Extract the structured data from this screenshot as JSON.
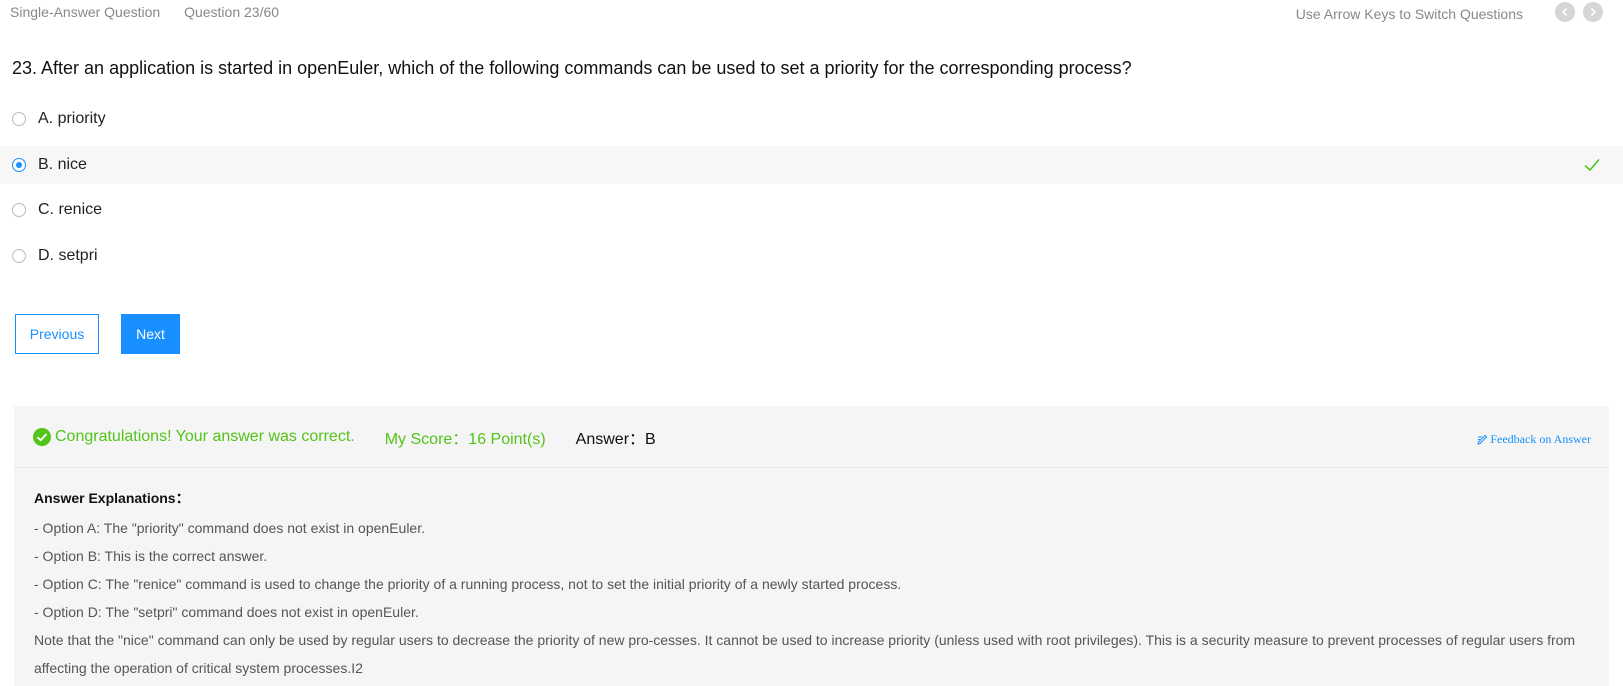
{
  "header": {
    "type": "Single-Answer Question",
    "progress": "Question 23/60",
    "hint": "Use Arrow Keys to Switch Questions",
    "prev_icon": "‹",
    "next_icon": "›"
  },
  "question": {
    "text": "23. After an application is started in openEuler, which of the following commands can be used to set a priority for the corresponding process?"
  },
  "options": [
    {
      "label": "A. priority",
      "selected": false
    },
    {
      "label": "B. nice",
      "selected": true,
      "correct": true
    },
    {
      "label": "C. renice",
      "selected": false
    },
    {
      "label": "D. setpri",
      "selected": false
    }
  ],
  "buttons": {
    "previous": "Previous",
    "next": "Next"
  },
  "result": {
    "message": "Congratulations! Your answer was correct.",
    "score": "My Score：16 Point(s)",
    "answer": "Answer：B",
    "feedback": "Feedback on Answer"
  },
  "explanation": {
    "title": "Answer Explanations：",
    "lines": [
      "- Option A: The \"priority\" command does not exist in openEuler.",
      "- Option B: This is the correct answer.",
      "- Option C: The \"renice\" command is used to change the priority of a running process, not to set the initial priority of a newly started process.",
      "- Option D: The \"setpri\" command does not exist in openEuler.",
      "Note that the \"nice\" command can only be used by regular users to decrease the priority of new pro-cesses. It cannot be used to increase priority (unless used with root privileges). This is a security measure to prevent processes of regular users from affecting the operation of critical system processes.I2"
    ]
  },
  "colors": {
    "accent": "#1890ff",
    "success": "#52c41a",
    "panel": "#f5f5f5"
  }
}
